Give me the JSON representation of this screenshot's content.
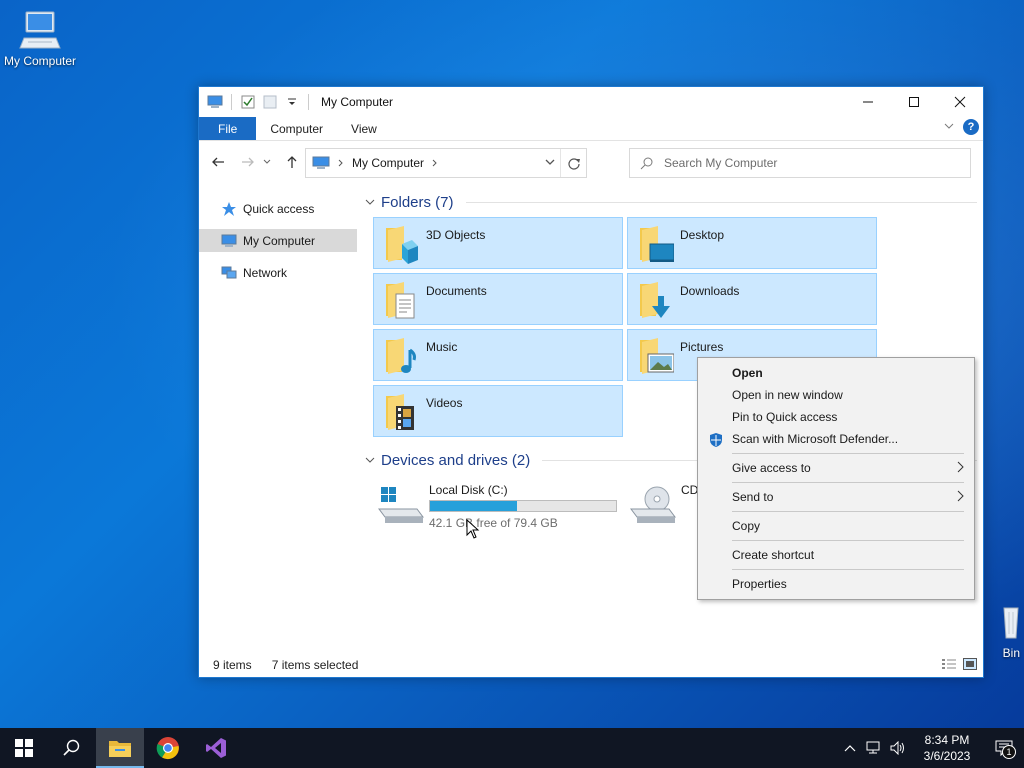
{
  "desktop": {
    "icons": [
      {
        "label": "My Computer"
      },
      {
        "label": "Bin"
      }
    ]
  },
  "window": {
    "title": "My Computer",
    "ribbon_tabs": [
      "File",
      "Computer",
      "View"
    ],
    "address": {
      "crumb": "My Computer"
    },
    "search": {
      "placeholder": "Search My Computer"
    },
    "nav_pane": [
      {
        "label": "Quick access"
      },
      {
        "label": "My Computer"
      },
      {
        "label": "Network"
      }
    ],
    "folders_header": "Folders (7)",
    "folders": [
      {
        "label": "3D Objects"
      },
      {
        "label": "Desktop"
      },
      {
        "label": "Documents"
      },
      {
        "label": "Downloads"
      },
      {
        "label": "Music"
      },
      {
        "label": "Pictures"
      },
      {
        "label": "Videos"
      }
    ],
    "drives_header": "Devices and drives (2)",
    "drives": [
      {
        "label": "Local Disk (C:)",
        "free_text": "42.1 GB free of 79.4 GB",
        "used_fraction": 0.47
      },
      {
        "label": "CD"
      }
    ],
    "status": {
      "items": "9 items",
      "selected": "7 items selected"
    }
  },
  "context_menu": {
    "items": [
      {
        "label": "Open"
      },
      {
        "label": "Open in new window"
      },
      {
        "label": "Pin to Quick access"
      },
      {
        "label": "Scan with Microsoft Defender..."
      },
      {
        "label": "Give access to"
      },
      {
        "label": "Send to"
      },
      {
        "label": "Copy"
      },
      {
        "label": "Create shortcut"
      },
      {
        "label": "Properties"
      }
    ]
  },
  "taskbar": {
    "clock_time": "8:34 PM",
    "clock_date": "3/6/2023",
    "notification_count": "1"
  },
  "colors": {
    "accent": "#1a6bc4",
    "selection": "#cce8ff",
    "taskbar": "#101623"
  }
}
